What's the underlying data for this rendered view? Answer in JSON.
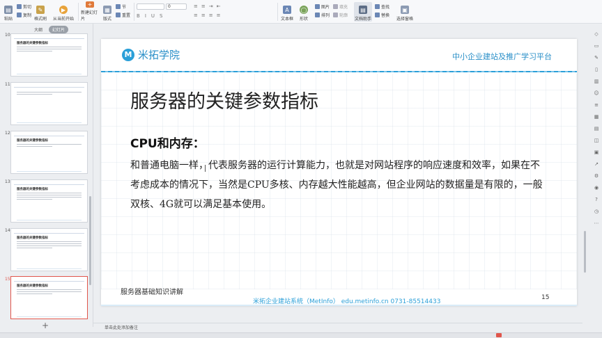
{
  "ribbon": {
    "paste": "粘贴",
    "cut": "剪切",
    "copy": "复制",
    "format_painter": "格式刷",
    "play_from_current": "从当前开始",
    "new_slide": "新建幻灯片",
    "layout": "版式",
    "section": "节",
    "reset": "重置",
    "textbox": "文本框",
    "shape": "形状",
    "arrange": "排列",
    "picture": "图片",
    "fill": "填充",
    "outline": "轮廓",
    "find": "查找",
    "replace": "替换",
    "text_tools": "文档助手",
    "select_pane": "选择窗格",
    "font_size_value": "0"
  },
  "left_panel": {
    "tab_outline": "大纲",
    "tab_slides": "幻灯片",
    "slides": [
      {
        "num": "10",
        "title": "服务器的关键参数指标"
      },
      {
        "num": "11",
        "title": ""
      },
      {
        "num": "12",
        "title": "服务器的关键参数指标"
      },
      {
        "num": "13",
        "title": "服务器的关键参数指标"
      },
      {
        "num": "14",
        "title": "服务器的关键参数指标"
      },
      {
        "num": "15",
        "title": "服务器的关键参数指标"
      }
    ],
    "add_slide": "+"
  },
  "slide": {
    "logo_letter": "M",
    "logo_text": "米拓学院",
    "tagline": "中小企业建站及推广学习平台",
    "title": "服务器的关键参数指标",
    "subtitle": "CPU和内存：",
    "body": "和普通电脑一样，代表服务器的运行计算能力，也就是对网站程序的响应速度和效率，如果在不考虑成本的情况下，当然是CPU多核、内存越大性能越高，但企业网站的数据量是有限的，一般双核、4G就可以满足基本使用。",
    "footer_left": "服务器基础知识讲解",
    "footer_center": "米拓企业建站系统（MetInfo） edu.metinfo.cn 0731-85514433",
    "page_number": "15"
  },
  "notes": {
    "placeholder": "单击此处添加备注"
  },
  "colors": {
    "brand": "#2a9fd8",
    "selected_thumb": "#e0554b"
  }
}
